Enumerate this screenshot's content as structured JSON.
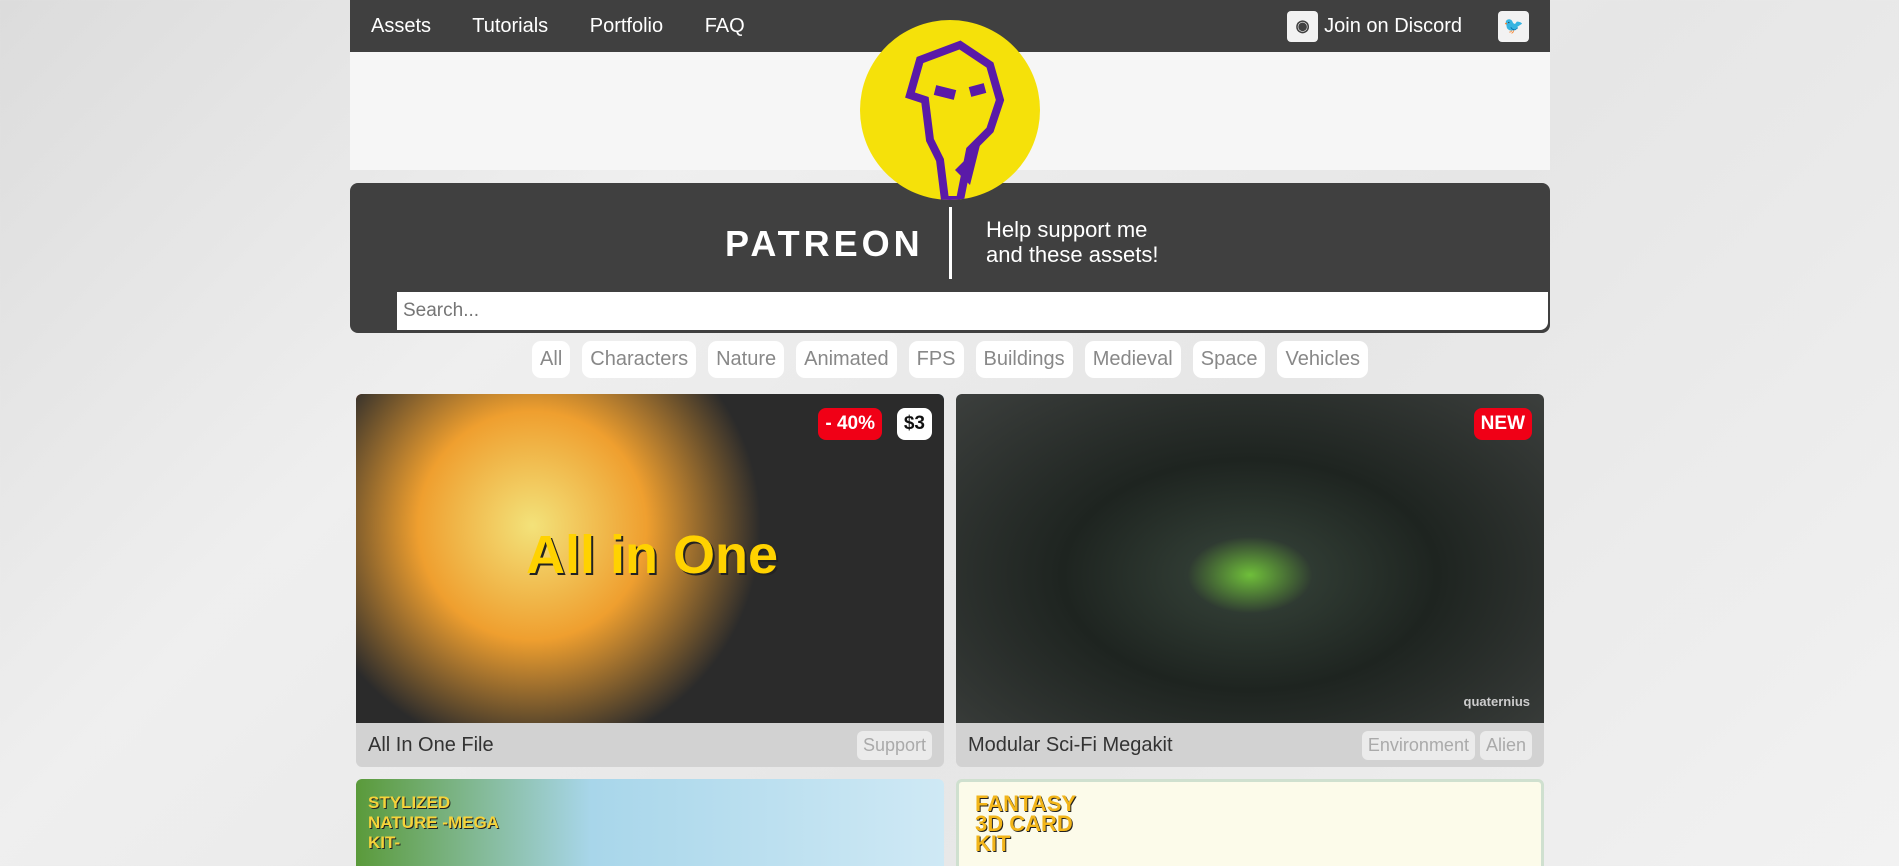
{
  "nav": {
    "links": [
      "Assets",
      "Tutorials",
      "Portfolio",
      "FAQ"
    ],
    "discord": "Join on Discord"
  },
  "patreon": {
    "name": "PATREON",
    "help_line1": "Help support me",
    "help_line2": "and these assets!"
  },
  "search": {
    "placeholder": "Search..."
  },
  "filters": [
    "All",
    "Characters",
    "Nature",
    "Animated",
    "FPS",
    "Buildings",
    "Medieval",
    "Space",
    "Vehicles"
  ],
  "cards": [
    {
      "title": "All In One File",
      "tags": [
        "Support"
      ],
      "badges": [
        "- 40%",
        "$3"
      ],
      "image_text": "All in One"
    },
    {
      "title": "Modular Sci-Fi Megakit",
      "tags": [
        "Environment",
        "Alien"
      ],
      "badges": [
        "NEW"
      ],
      "watermark": "quaternius"
    },
    {
      "image_text": "STYLIZED NATURE -MEGA KIT-"
    },
    {
      "image_text": "FANTASY 3D CARD KIT"
    }
  ]
}
